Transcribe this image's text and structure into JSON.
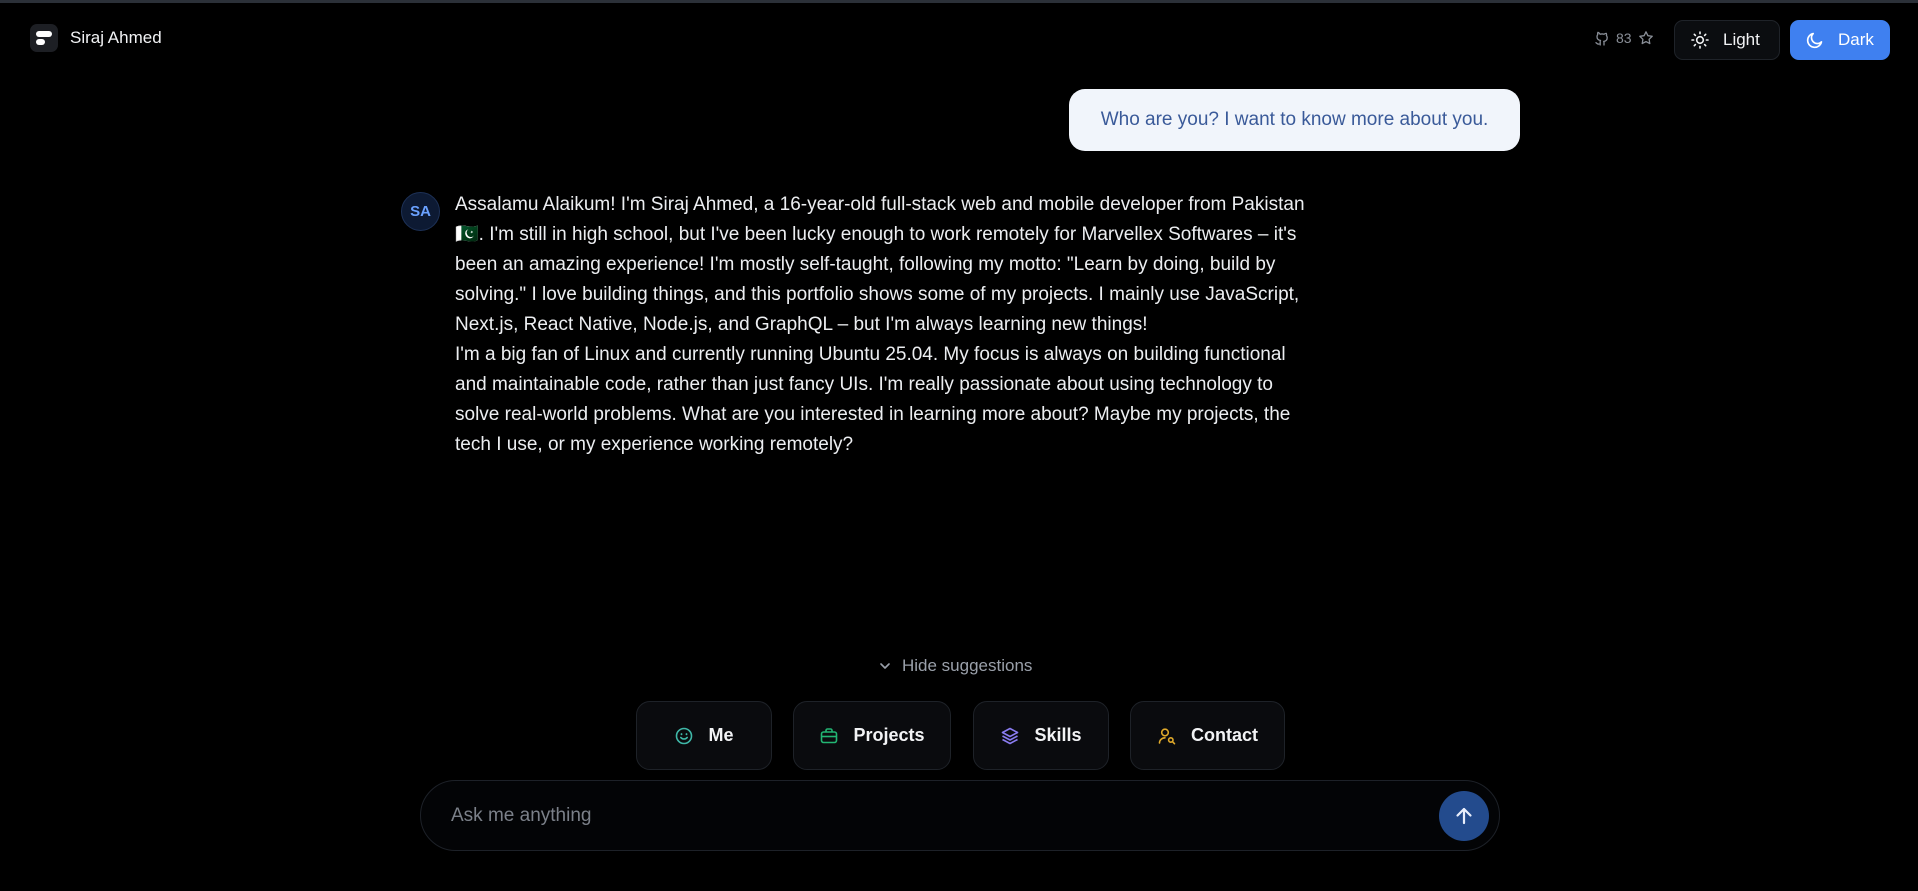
{
  "header": {
    "brand_name": "Siraj Ahmed",
    "github_stars": "83",
    "light_label": "Light",
    "dark_label": "Dark"
  },
  "chat": {
    "user_message": "Who are you? I want to know more about you.",
    "assistant_initials": "SA",
    "assistant_paragraphs": [
      "Assalamu Alaikum!  I'm Siraj Ahmed, a 16-year-old full-stack web and mobile developer from Pakistan 🇵🇰.  I'm still in high school, but I've been lucky enough to work remotely for Marvellex Softwares – it's been an amazing experience!  I'm mostly self-taught, following my motto: \"Learn by doing, build by solving.\"  I love building things, and this portfolio shows some of my projects.  I mainly use JavaScript,  Next.js, React Native, Node.js, and GraphQL –  but I'm always learning new things!",
      "I'm a big fan of Linux and currently running Ubuntu 25.04.  My focus is always on building functional and maintainable code, rather than just fancy UIs.  I'm really passionate about using technology to solve real-world problems.  What are you interested in learning more about?  Maybe my projects, the tech I use, or my experience working remotely?"
    ]
  },
  "suggestions": {
    "toggle_label": "Hide suggestions",
    "chips": [
      {
        "label": "Me",
        "icon": "smile-icon",
        "color": "#3fb8a8"
      },
      {
        "label": "Projects",
        "icon": "briefcase-icon",
        "color": "#22b573"
      },
      {
        "label": "Skills",
        "icon": "layers-icon",
        "color": "#8a7cf0"
      },
      {
        "label": "Contact",
        "icon": "user-search-icon",
        "color": "#e0a92a"
      }
    ]
  },
  "input": {
    "placeholder": "Ask me anything"
  },
  "colors": {
    "accent": "#3f80f0",
    "background": "#000000"
  }
}
